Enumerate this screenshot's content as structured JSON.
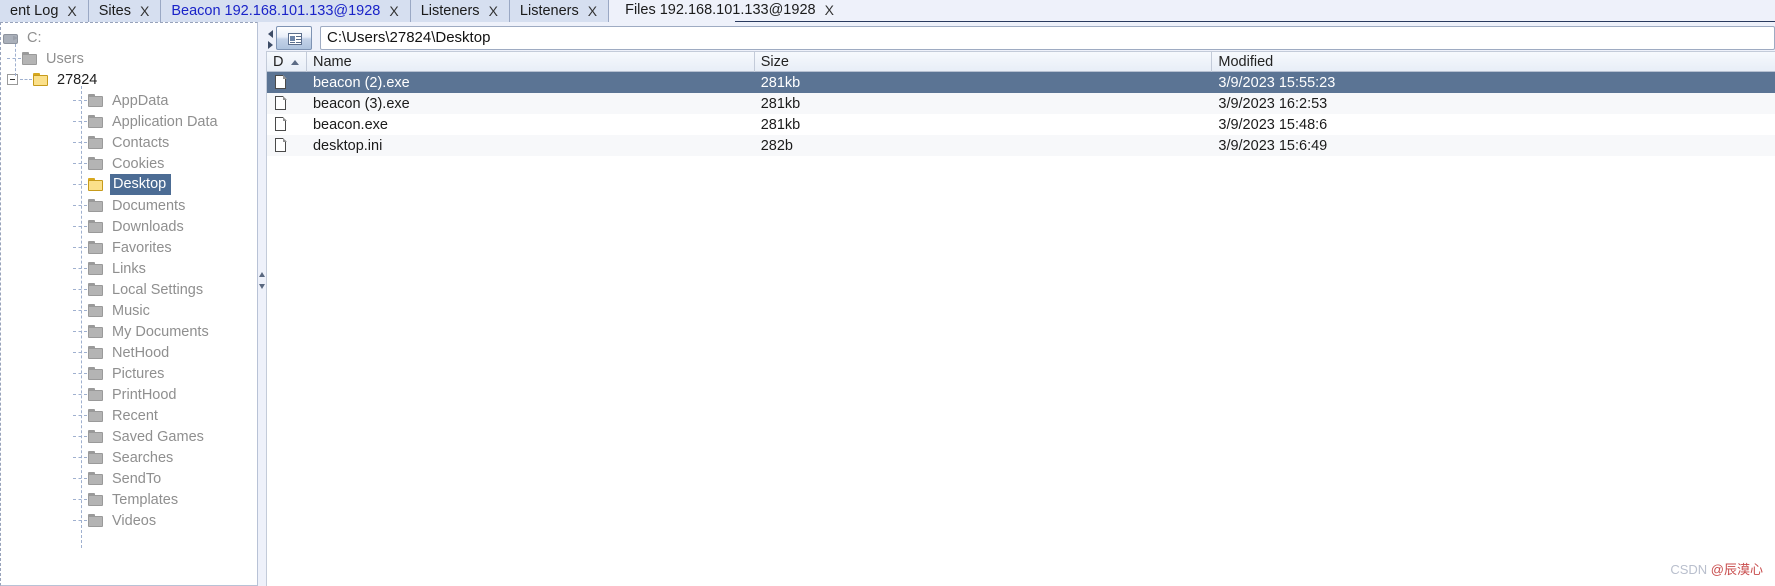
{
  "window": {
    "app": "file-browser",
    "accent_selected": "#5b7494",
    "tree_selected": "#4c6c94",
    "link_color": "#1a23c8"
  },
  "tabs": [
    {
      "label": "ent Log",
      "close": "X",
      "active": false,
      "style": "normal"
    },
    {
      "label": "Sites",
      "close": "X",
      "active": false,
      "style": "normal"
    },
    {
      "label": "Beacon 192.168.101.133@1928",
      "close": "X",
      "active": false,
      "style": "link"
    },
    {
      "label": "Listeners",
      "close": "X",
      "active": false,
      "style": "normal"
    },
    {
      "label": "Listeners",
      "close": "X",
      "active": false,
      "style": "normal"
    },
    {
      "label": "Files 192.168.101.133@1928",
      "close": "X",
      "active": true,
      "style": "normal"
    }
  ],
  "toolbar": {
    "path_value": "C:\\Users\\27824\\Desktop",
    "path_placeholder": "C:\\",
    "list_button_icon": "file-list-icon",
    "nav_up_icon": "nav-left-icon",
    "nav_down_icon": "nav-right-icon"
  },
  "tree": {
    "root": {
      "label": "C:",
      "icon": "drive-icon"
    },
    "items": [
      {
        "label": "Users",
        "depth": 1,
        "icon": "folder-grey",
        "expanded": false,
        "handle": "dash",
        "selected": false,
        "dim": true
      },
      {
        "label": "27824",
        "depth": 1,
        "icon": "folder-yellow",
        "expanded": true,
        "handle": "minus",
        "selected": false,
        "dim": false
      },
      {
        "label": "AppData",
        "depth": 2,
        "icon": "folder-grey",
        "expanded": false,
        "handle": "dash",
        "selected": false,
        "dim": true
      },
      {
        "label": "Application Data",
        "depth": 2,
        "icon": "folder-grey",
        "expanded": false,
        "handle": "dash",
        "selected": false,
        "dim": true
      },
      {
        "label": "Contacts",
        "depth": 2,
        "icon": "folder-grey",
        "expanded": false,
        "handle": "dash",
        "selected": false,
        "dim": true
      },
      {
        "label": "Cookies",
        "depth": 2,
        "icon": "folder-grey",
        "expanded": false,
        "handle": "dash",
        "selected": false,
        "dim": true
      },
      {
        "label": "Desktop",
        "depth": 2,
        "icon": "folder-yellow",
        "expanded": false,
        "handle": "dash",
        "selected": true,
        "dim": false
      },
      {
        "label": "Documents",
        "depth": 2,
        "icon": "folder-grey",
        "expanded": false,
        "handle": "dash",
        "selected": false,
        "dim": true
      },
      {
        "label": "Downloads",
        "depth": 2,
        "icon": "folder-grey",
        "expanded": false,
        "handle": "dash",
        "selected": false,
        "dim": true
      },
      {
        "label": "Favorites",
        "depth": 2,
        "icon": "folder-grey",
        "expanded": false,
        "handle": "dash",
        "selected": false,
        "dim": true
      },
      {
        "label": "Links",
        "depth": 2,
        "icon": "folder-grey",
        "expanded": false,
        "handle": "dash",
        "selected": false,
        "dim": true
      },
      {
        "label": "Local Settings",
        "depth": 2,
        "icon": "folder-grey",
        "expanded": false,
        "handle": "dash",
        "selected": false,
        "dim": true
      },
      {
        "label": "Music",
        "depth": 2,
        "icon": "folder-grey",
        "expanded": false,
        "handle": "dash",
        "selected": false,
        "dim": true
      },
      {
        "label": "My Documents",
        "depth": 2,
        "icon": "folder-grey",
        "expanded": false,
        "handle": "dash",
        "selected": false,
        "dim": true
      },
      {
        "label": "NetHood",
        "depth": 2,
        "icon": "folder-grey",
        "expanded": false,
        "handle": "dash",
        "selected": false,
        "dim": true
      },
      {
        "label": "Pictures",
        "depth": 2,
        "icon": "folder-grey",
        "expanded": false,
        "handle": "dash",
        "selected": false,
        "dim": true
      },
      {
        "label": "PrintHood",
        "depth": 2,
        "icon": "folder-grey",
        "expanded": false,
        "handle": "dash",
        "selected": false,
        "dim": true
      },
      {
        "label": "Recent",
        "depth": 2,
        "icon": "folder-grey",
        "expanded": false,
        "handle": "dash",
        "selected": false,
        "dim": true
      },
      {
        "label": "Saved Games",
        "depth": 2,
        "icon": "folder-grey",
        "expanded": false,
        "handle": "dash",
        "selected": false,
        "dim": true
      },
      {
        "label": "Searches",
        "depth": 2,
        "icon": "folder-grey",
        "expanded": false,
        "handle": "dash",
        "selected": false,
        "dim": true
      },
      {
        "label": "SendTo",
        "depth": 2,
        "icon": "folder-grey",
        "expanded": false,
        "handle": "dash",
        "selected": false,
        "dim": true
      },
      {
        "label": "Templates",
        "depth": 2,
        "icon": "folder-grey",
        "expanded": false,
        "handle": "dash",
        "selected": false,
        "dim": true
      },
      {
        "label": "Videos",
        "depth": 2,
        "icon": "folder-grey",
        "expanded": false,
        "handle": "dash",
        "selected": false,
        "dim": true
      }
    ]
  },
  "table": {
    "columns": [
      {
        "key": "d",
        "label": "D",
        "sorted": "asc"
      },
      {
        "key": "name",
        "label": "Name",
        "sorted": "none"
      },
      {
        "key": "size",
        "label": "Size",
        "sorted": "none"
      },
      {
        "key": "mod",
        "label": "Modified",
        "sorted": "none"
      }
    ],
    "rows": [
      {
        "icon": "file-icon",
        "name": "beacon (2).exe",
        "size": "281kb",
        "modified": "3/9/2023 15:55:23",
        "selected": true
      },
      {
        "icon": "file-icon",
        "name": "beacon (3).exe",
        "size": "281kb",
        "modified": "3/9/2023 16:2:53",
        "selected": false
      },
      {
        "icon": "file-icon",
        "name": "beacon.exe",
        "size": "281kb",
        "modified": "3/9/2023 15:48:6",
        "selected": false
      },
      {
        "icon": "file-icon",
        "name": "desktop.ini",
        "size": "282b",
        "modified": "3/9/2023 15:6:49",
        "selected": false
      }
    ]
  },
  "watermark": {
    "prefix": "CSDN ",
    "handle": "@辰漠心"
  }
}
